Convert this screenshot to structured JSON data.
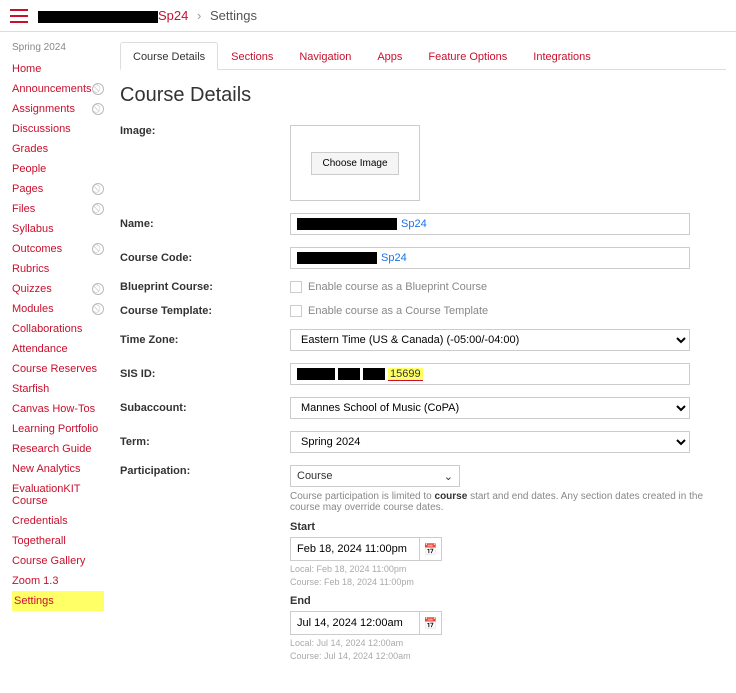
{
  "breadcrumb": {
    "course_suffix": "Sp24",
    "sep": "›",
    "current": "Settings"
  },
  "leftnav": {
    "term": "Spring 2024",
    "items": [
      {
        "label": "Home",
        "hidden": false
      },
      {
        "label": "Announcements",
        "hidden": true
      },
      {
        "label": "Assignments",
        "hidden": true
      },
      {
        "label": "Discussions",
        "hidden": false
      },
      {
        "label": "Grades",
        "hidden": false
      },
      {
        "label": "People",
        "hidden": false
      },
      {
        "label": "Pages",
        "hidden": true
      },
      {
        "label": "Files",
        "hidden": true
      },
      {
        "label": "Syllabus",
        "hidden": false
      },
      {
        "label": "Outcomes",
        "hidden": true
      },
      {
        "label": "Rubrics",
        "hidden": false
      },
      {
        "label": "Quizzes",
        "hidden": true
      },
      {
        "label": "Modules",
        "hidden": true
      },
      {
        "label": "Collaborations",
        "hidden": false
      },
      {
        "label": "Attendance",
        "hidden": false
      },
      {
        "label": "Course Reserves",
        "hidden": false
      },
      {
        "label": "Starfish",
        "hidden": false
      },
      {
        "label": "Canvas How-Tos",
        "hidden": false
      },
      {
        "label": "Learning Portfolio",
        "hidden": false
      },
      {
        "label": "Research Guide",
        "hidden": false
      },
      {
        "label": "New Analytics",
        "hidden": false
      },
      {
        "label": "EvaluationKIT Course",
        "hidden": false
      },
      {
        "label": "Credentials",
        "hidden": false
      },
      {
        "label": "Togetherall",
        "hidden": false
      },
      {
        "label": "Course Gallery",
        "hidden": false
      },
      {
        "label": "Zoom 1.3",
        "hidden": false
      },
      {
        "label": "Settings",
        "hidden": false,
        "active": true
      }
    ]
  },
  "tabs": [
    {
      "label": "Course Details",
      "active": true
    },
    {
      "label": "Sections"
    },
    {
      "label": "Navigation"
    },
    {
      "label": "Apps"
    },
    {
      "label": "Feature Options"
    },
    {
      "label": "Integrations"
    }
  ],
  "page_title": "Course Details",
  "fields": {
    "image_label": "Image:",
    "choose_image": "Choose Image",
    "name_label": "Name:",
    "name_suffix": "Sp24",
    "code_label": "Course Code:",
    "code_suffix": "Sp24",
    "blueprint_label": "Blueprint Course:",
    "blueprint_text": "Enable course as a Blueprint Course",
    "template_label": "Course Template:",
    "template_text": "Enable course as a Course Template",
    "tz_label": "Time Zone:",
    "tz_value": "Eastern Time (US & Canada) (-05:00/-04:00)",
    "sis_label": "SIS ID:",
    "sis_highlight": "15699",
    "subaccount_label": "Subaccount:",
    "subaccount_value": "Mannes School of Music (CoPA)",
    "term_label": "Term:",
    "term_value": "Spring 2024",
    "participation_label": "Participation:",
    "participation_value": "Course",
    "participation_hint_pre": "Course participation is limited to ",
    "participation_hint_bold": "course",
    "participation_hint_post": " start and end dates. Any section dates created in the course may override course dates.",
    "start_label": "Start",
    "start_value": "Feb 18, 2024 11:00pm",
    "start_note1": "Local: Feb 18, 2024 11:00pm",
    "start_note2": "Course: Feb 18, 2024 11:00pm",
    "end_label": "End",
    "end_value": "Jul 14, 2024 12:00am",
    "end_note1": "Local: Jul 14, 2024 12:00am",
    "end_note2": "Course: Jul 14, 2024 12:00am"
  }
}
